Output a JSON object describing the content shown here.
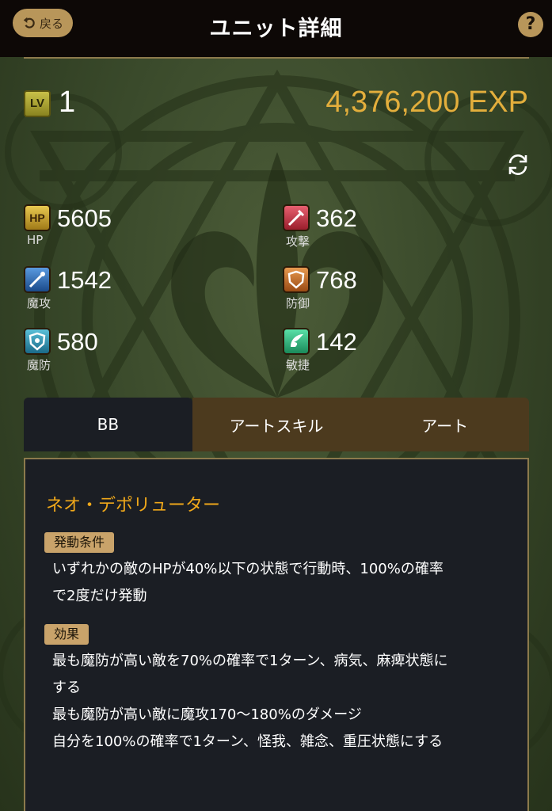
{
  "header": {
    "back_label": "戻る",
    "title": "ユニット詳細",
    "help_label": "?"
  },
  "level": {
    "icon_label": "LV",
    "value": "1",
    "exp": "4,376,200 EXP"
  },
  "stats": [
    {
      "key": "hp",
      "label": "HP",
      "value": "5605",
      "icon_label": "HP",
      "color": "#c8a428"
    },
    {
      "key": "attack",
      "label": "攻撃",
      "value": "362",
      "color": "#c23a48"
    },
    {
      "key": "magic_attack",
      "label": "魔攻",
      "value": "1542",
      "color": "#2f6fb6"
    },
    {
      "key": "defense",
      "label": "防御",
      "value": "768",
      "color": "#c86a28"
    },
    {
      "key": "magic_defense",
      "label": "魔防",
      "value": "580",
      "color": "#2a8aa8"
    },
    {
      "key": "agility",
      "label": "敏捷",
      "value": "142",
      "color": "#28a478"
    }
  ],
  "tabs": [
    {
      "label": "BB",
      "active": true
    },
    {
      "label": "アートスキル",
      "active": false
    },
    {
      "label": "アート",
      "active": false
    }
  ],
  "skill": {
    "name": "ネオ・デポリューター",
    "condition_tag": "発動条件",
    "condition_lines": [
      "いずれかの敵のHPが40%以下の状態で行動時、100%の確率",
      "で2度だけ発動"
    ],
    "effect_tag": "効果",
    "effect_lines": [
      "最も魔防が高い敵を70%の確率で1ターン、病気、麻痺状態に",
      "する",
      "最も魔防が高い敵に魔攻170〜180%のダメージ",
      "自分を100%の確率で1ターン、怪我、雑念、重圧状態にする"
    ]
  },
  "colors": {
    "accent_gold": "#e3ae3c",
    "skill_name": "#f0a81a",
    "panel_bg": "#1b1e24"
  }
}
